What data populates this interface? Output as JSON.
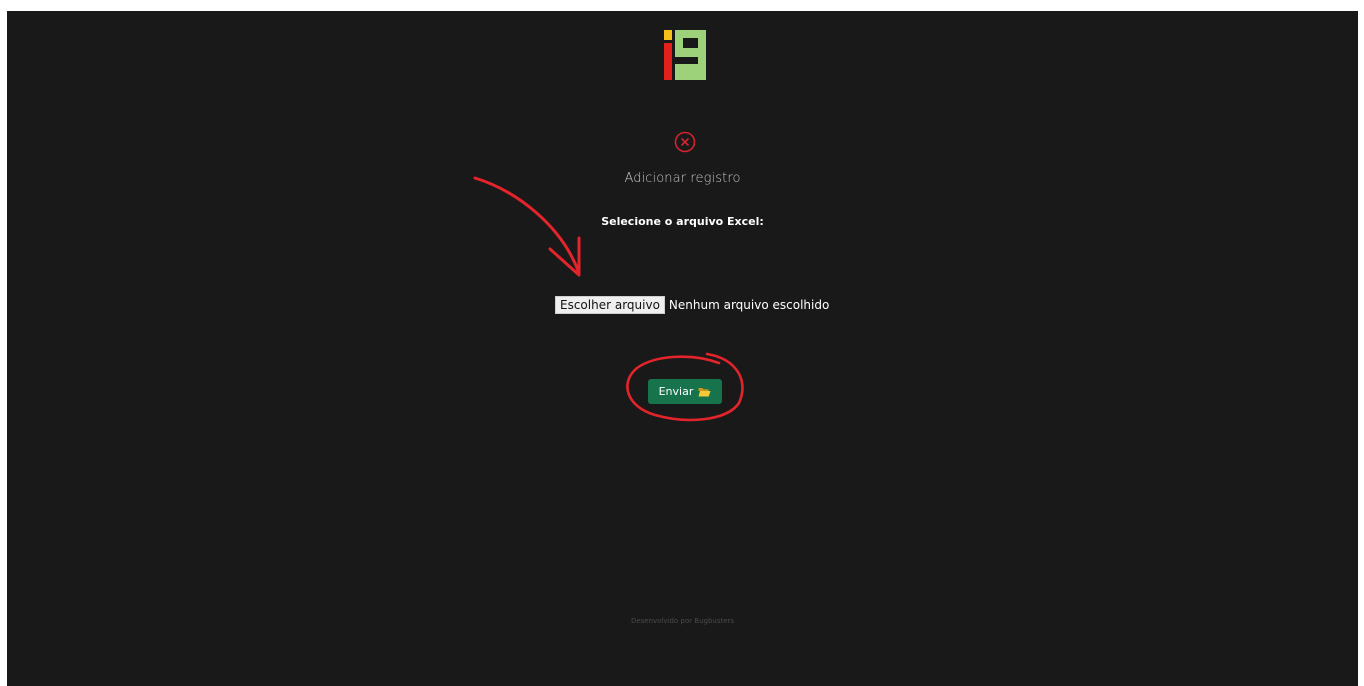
{
  "modal": {
    "title": "Adicionar registro",
    "prompt": "Selecione o arquivo Excel:"
  },
  "file_input": {
    "button_label": "Escolher arquivo",
    "status": "Nenhum arquivo escolhido"
  },
  "submit": {
    "label": "Enviar",
    "icon": "open-folder-icon"
  },
  "footer": {
    "text": "Desenvolvido por Bugbusters"
  },
  "colors": {
    "background": "#191919",
    "logo_yellow": "#f5c01a",
    "logo_red": "#e3201b",
    "logo_green": "#9ed27a",
    "close_icon": "#d2232e",
    "button_green": "#17734b",
    "annotation_red": "#e3242b"
  }
}
